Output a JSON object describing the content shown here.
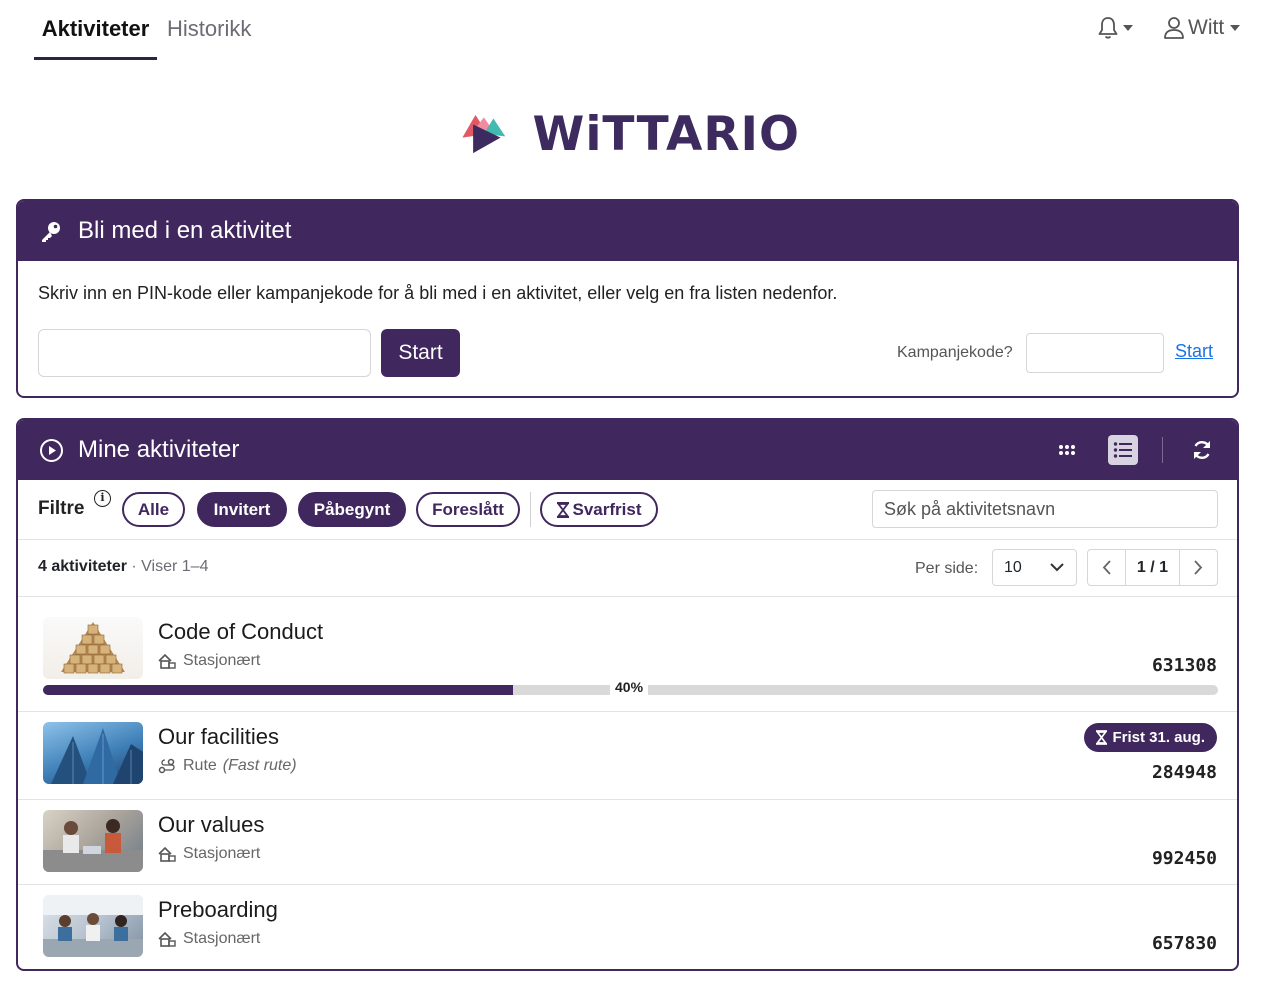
{
  "nav": {
    "tab_active": "Aktiviteter",
    "tab_history": "Historikk",
    "user_name": "Witt"
  },
  "logo": {
    "text": "WiTTARIO"
  },
  "join": {
    "title": "Bli med i en aktivitet",
    "description": "Skriv inn en PIN-kode eller kampanjekode for å bli med i en aktivitet, eller velg en fra listen nedenfor.",
    "pin_value": "",
    "start_label": "Start",
    "campaign_label": "Kampanjekode?",
    "campaign_value": "",
    "campaign_start": "Start"
  },
  "mine": {
    "title": "Mine aktiviteter",
    "filter_label": "Filtre",
    "filters": [
      {
        "label": "Alle",
        "active": false
      },
      {
        "label": "Invitert",
        "active": true
      },
      {
        "label": "Påbegynt",
        "active": true
      },
      {
        "label": "Foreslått",
        "active": false
      },
      {
        "label": "Svarfrist",
        "active": false
      }
    ],
    "search_placeholder": "Søk på aktivitetsnavn",
    "count_bold": "4 aktiviteter",
    "count_rest": "· Viser 1–4",
    "per_page_label": "Per side:",
    "per_page_value": "10",
    "page": "1 / 1",
    "activities": [
      {
        "title": "Code of Conduct",
        "type": "Stasjonært",
        "type_note": "",
        "code": "631308",
        "progress": 40,
        "progress_label": "40%",
        "deadline": ""
      },
      {
        "title": "Our facilities",
        "type": "Rute",
        "type_note": "(Fast rute)",
        "code": "284948",
        "deadline": "Frist 31. aug."
      },
      {
        "title": "Our values",
        "type": "Stasjonært",
        "type_note": "",
        "code": "992450",
        "deadline": ""
      },
      {
        "title": "Preboarding",
        "type": "Stasjonært",
        "type_note": "",
        "code": "657830",
        "deadline": ""
      }
    ]
  },
  "colors": {
    "brand": "#40275e",
    "link": "#1a73e8",
    "progress_bg": "#d9d9d9"
  }
}
